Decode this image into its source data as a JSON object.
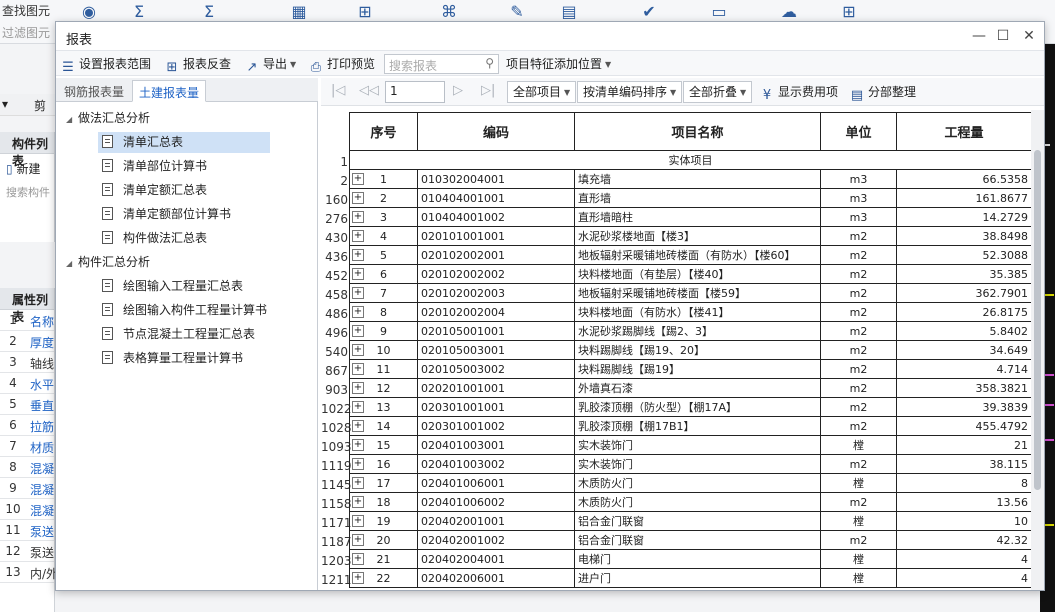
{
  "background": {
    "find_label": "查找图元",
    "filter_label": "过滤图元",
    "strip_label": "剪",
    "component_list_title": "构件列表",
    "new_label": "新建",
    "search_component_placeholder": "搜索构件",
    "property_list_title": "属性列表",
    "property_rows": [
      {
        "num": "1",
        "label": "名称",
        "blue": true
      },
      {
        "num": "2",
        "label": "厚度",
        "blue": true
      },
      {
        "num": "3",
        "label": "轴线",
        "blue": false
      },
      {
        "num": "4",
        "label": "水平",
        "blue": true
      },
      {
        "num": "5",
        "label": "垂直",
        "blue": true
      },
      {
        "num": "6",
        "label": "拉筋",
        "blue": true
      },
      {
        "num": "7",
        "label": "材质",
        "blue": true
      },
      {
        "num": "8",
        "label": "混凝",
        "blue": true
      },
      {
        "num": "9",
        "label": "混凝",
        "blue": true
      },
      {
        "num": "10",
        "label": "混凝",
        "blue": true
      },
      {
        "num": "11",
        "label": "泵送",
        "blue": true
      },
      {
        "num": "12",
        "label": "泵送",
        "blue": false
      },
      {
        "num": "13",
        "label": "内/外",
        "blue": false
      }
    ]
  },
  "window": {
    "title": "报表",
    "minimize": "—",
    "maximize": "☐",
    "close": "✕"
  },
  "toolbar": {
    "set_range": "设置报表范围",
    "reverse_check": "报表反查",
    "export": "导出",
    "print_preview": "打印预览",
    "search_placeholder": "搜索报表",
    "feature_position": "项目特征添加位置"
  },
  "tabs": {
    "rebar": "钢筋报表量",
    "civil": "土建报表量"
  },
  "tree": {
    "group1": "做法汇总分析",
    "group1_items": [
      "清单汇总表",
      "清单部位计算书",
      "清单定额汇总表",
      "清单定额部位计算书",
      "构件做法汇总表"
    ],
    "group2": "构件汇总分析",
    "group2_items": [
      "绘图输入工程量汇总表",
      "绘图输入构件工程量计算书",
      "节点混凝土工程量汇总表",
      "表格算量工程量计算书"
    ]
  },
  "nav": {
    "page": "1",
    "all_items": "全部项目",
    "sort_by": "按清单编码排序",
    "collapse_all": "全部折叠",
    "show_fee": "显示费用项",
    "section_arrange": "分部整理"
  },
  "table": {
    "headers": [
      "序号",
      "编码",
      "项目名称",
      "单位",
      "工程量"
    ],
    "section_rownum": "1",
    "section_title": "实体项目",
    "rows": [
      {
        "rn": "2",
        "seq": "1",
        "code": "010302004001",
        "name": "填充墙",
        "unit": "m3",
        "qty": "66.5358"
      },
      {
        "rn": "160",
        "seq": "2",
        "code": "010404001001",
        "name": "直形墙",
        "unit": "m3",
        "qty": "161.8677"
      },
      {
        "rn": "276",
        "seq": "3",
        "code": "010404001002",
        "name": "直形墙暗柱",
        "unit": "m3",
        "qty": "14.2729"
      },
      {
        "rn": "430",
        "seq": "4",
        "code": "020101001001",
        "name": "水泥砂浆楼地面【楼3】",
        "unit": "m2",
        "qty": "38.8498"
      },
      {
        "rn": "436",
        "seq": "5",
        "code": "020102002001",
        "name": "地板辐射采暖铺地砖楼面（有防水）【楼60】",
        "unit": "m2",
        "qty": "52.3088"
      },
      {
        "rn": "452",
        "seq": "6",
        "code": "020102002002",
        "name": "块料楼地面（有垫层）【楼40】",
        "unit": "m2",
        "qty": "35.385"
      },
      {
        "rn": "458",
        "seq": "7",
        "code": "020102002003",
        "name": "地板辐射采暖铺地砖楼面【楼59】",
        "unit": "m2",
        "qty": "362.7901"
      },
      {
        "rn": "486",
        "seq": "8",
        "code": "020102002004",
        "name": "块料楼地面（有防水）【楼41】",
        "unit": "m2",
        "qty": "26.8175"
      },
      {
        "rn": "496",
        "seq": "9",
        "code": "020105001001",
        "name": "水泥砂浆踢脚线【踢2、3】",
        "unit": "m2",
        "qty": "5.8402"
      },
      {
        "rn": "540",
        "seq": "10",
        "code": "020105003001",
        "name": "块料踢脚线【踢19、20】",
        "unit": "m2",
        "qty": "34.649"
      },
      {
        "rn": "867",
        "seq": "11",
        "code": "020105003002",
        "name": "块料踢脚线【踢19】",
        "unit": "m2",
        "qty": "4.714"
      },
      {
        "rn": "903",
        "seq": "12",
        "code": "020201001001",
        "name": "外墙真石漆",
        "unit": "m2",
        "qty": "358.3821"
      },
      {
        "rn": "1022",
        "seq": "13",
        "code": "020301001001",
        "name": "乳胶漆顶棚（防火型）【棚17A】",
        "unit": "m2",
        "qty": "39.3839"
      },
      {
        "rn": "1028",
        "seq": "14",
        "code": "020301001002",
        "name": "乳胶漆顶棚【棚17B1】",
        "unit": "m2",
        "qty": "455.4792"
      },
      {
        "rn": "1093",
        "seq": "15",
        "code": "020401003001",
        "name": "实木装饰门",
        "unit": "樘",
        "qty": "21"
      },
      {
        "rn": "1119",
        "seq": "16",
        "code": "020401003002",
        "name": "实木装饰门",
        "unit": "m2",
        "qty": "38.115"
      },
      {
        "rn": "1145",
        "seq": "17",
        "code": "020401006001",
        "name": "木质防火门",
        "unit": "樘",
        "qty": "8"
      },
      {
        "rn": "1158",
        "seq": "18",
        "code": "020401006002",
        "name": "木质防火门",
        "unit": "m2",
        "qty": "13.56"
      },
      {
        "rn": "1171",
        "seq": "19",
        "code": "020402001001",
        "name": "铝合金门联窗",
        "unit": "樘",
        "qty": "10"
      },
      {
        "rn": "1187",
        "seq": "20",
        "code": "020402001002",
        "name": "铝合金门联窗",
        "unit": "m2",
        "qty": "42.32"
      },
      {
        "rn": "1203",
        "seq": "21",
        "code": "020402004001",
        "name": "电梯门",
        "unit": "樘",
        "qty": "4"
      },
      {
        "rn": "1211",
        "seq": "22",
        "code": "020402006001",
        "name": "进户门",
        "unit": "樘",
        "qty": "4"
      }
    ]
  },
  "colors": {
    "accent": "#1f63c6",
    "selection": "#cfe1f6"
  }
}
